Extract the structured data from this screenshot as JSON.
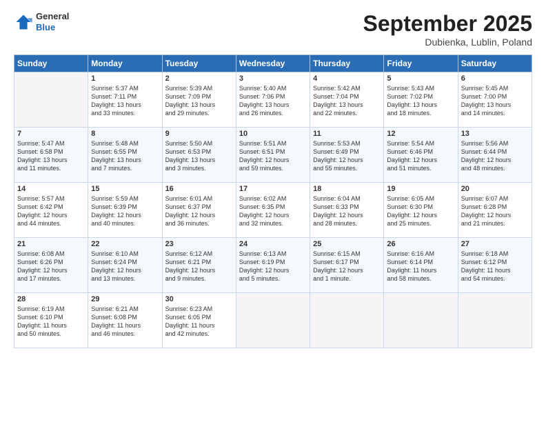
{
  "header": {
    "logo_general": "General",
    "logo_blue": "Blue",
    "month": "September 2025",
    "location": "Dubienka, Lublin, Poland"
  },
  "weekdays": [
    "Sunday",
    "Monday",
    "Tuesday",
    "Wednesday",
    "Thursday",
    "Friday",
    "Saturday"
  ],
  "weeks": [
    [
      {
        "day": "",
        "info": ""
      },
      {
        "day": "1",
        "info": "Sunrise: 5:37 AM\nSunset: 7:11 PM\nDaylight: 13 hours\nand 33 minutes."
      },
      {
        "day": "2",
        "info": "Sunrise: 5:39 AM\nSunset: 7:09 PM\nDaylight: 13 hours\nand 29 minutes."
      },
      {
        "day": "3",
        "info": "Sunrise: 5:40 AM\nSunset: 7:06 PM\nDaylight: 13 hours\nand 26 minutes."
      },
      {
        "day": "4",
        "info": "Sunrise: 5:42 AM\nSunset: 7:04 PM\nDaylight: 13 hours\nand 22 minutes."
      },
      {
        "day": "5",
        "info": "Sunrise: 5:43 AM\nSunset: 7:02 PM\nDaylight: 13 hours\nand 18 minutes."
      },
      {
        "day": "6",
        "info": "Sunrise: 5:45 AM\nSunset: 7:00 PM\nDaylight: 13 hours\nand 14 minutes."
      }
    ],
    [
      {
        "day": "7",
        "info": "Sunrise: 5:47 AM\nSunset: 6:58 PM\nDaylight: 13 hours\nand 11 minutes."
      },
      {
        "day": "8",
        "info": "Sunrise: 5:48 AM\nSunset: 6:55 PM\nDaylight: 13 hours\nand 7 minutes."
      },
      {
        "day": "9",
        "info": "Sunrise: 5:50 AM\nSunset: 6:53 PM\nDaylight: 13 hours\nand 3 minutes."
      },
      {
        "day": "10",
        "info": "Sunrise: 5:51 AM\nSunset: 6:51 PM\nDaylight: 12 hours\nand 59 minutes."
      },
      {
        "day": "11",
        "info": "Sunrise: 5:53 AM\nSunset: 6:49 PM\nDaylight: 12 hours\nand 55 minutes."
      },
      {
        "day": "12",
        "info": "Sunrise: 5:54 AM\nSunset: 6:46 PM\nDaylight: 12 hours\nand 51 minutes."
      },
      {
        "day": "13",
        "info": "Sunrise: 5:56 AM\nSunset: 6:44 PM\nDaylight: 12 hours\nand 48 minutes."
      }
    ],
    [
      {
        "day": "14",
        "info": "Sunrise: 5:57 AM\nSunset: 6:42 PM\nDaylight: 12 hours\nand 44 minutes."
      },
      {
        "day": "15",
        "info": "Sunrise: 5:59 AM\nSunset: 6:39 PM\nDaylight: 12 hours\nand 40 minutes."
      },
      {
        "day": "16",
        "info": "Sunrise: 6:01 AM\nSunset: 6:37 PM\nDaylight: 12 hours\nand 36 minutes."
      },
      {
        "day": "17",
        "info": "Sunrise: 6:02 AM\nSunset: 6:35 PM\nDaylight: 12 hours\nand 32 minutes."
      },
      {
        "day": "18",
        "info": "Sunrise: 6:04 AM\nSunset: 6:33 PM\nDaylight: 12 hours\nand 28 minutes."
      },
      {
        "day": "19",
        "info": "Sunrise: 6:05 AM\nSunset: 6:30 PM\nDaylight: 12 hours\nand 25 minutes."
      },
      {
        "day": "20",
        "info": "Sunrise: 6:07 AM\nSunset: 6:28 PM\nDaylight: 12 hours\nand 21 minutes."
      }
    ],
    [
      {
        "day": "21",
        "info": "Sunrise: 6:08 AM\nSunset: 6:26 PM\nDaylight: 12 hours\nand 17 minutes."
      },
      {
        "day": "22",
        "info": "Sunrise: 6:10 AM\nSunset: 6:24 PM\nDaylight: 12 hours\nand 13 minutes."
      },
      {
        "day": "23",
        "info": "Sunrise: 6:12 AM\nSunset: 6:21 PM\nDaylight: 12 hours\nand 9 minutes."
      },
      {
        "day": "24",
        "info": "Sunrise: 6:13 AM\nSunset: 6:19 PM\nDaylight: 12 hours\nand 5 minutes."
      },
      {
        "day": "25",
        "info": "Sunrise: 6:15 AM\nSunset: 6:17 PM\nDaylight: 12 hours\nand 1 minute."
      },
      {
        "day": "26",
        "info": "Sunrise: 6:16 AM\nSunset: 6:14 PM\nDaylight: 11 hours\nand 58 minutes."
      },
      {
        "day": "27",
        "info": "Sunrise: 6:18 AM\nSunset: 6:12 PM\nDaylight: 11 hours\nand 54 minutes."
      }
    ],
    [
      {
        "day": "28",
        "info": "Sunrise: 6:19 AM\nSunset: 6:10 PM\nDaylight: 11 hours\nand 50 minutes."
      },
      {
        "day": "29",
        "info": "Sunrise: 6:21 AM\nSunset: 6:08 PM\nDaylight: 11 hours\nand 46 minutes."
      },
      {
        "day": "30",
        "info": "Sunrise: 6:23 AM\nSunset: 6:05 PM\nDaylight: 11 hours\nand 42 minutes."
      },
      {
        "day": "",
        "info": ""
      },
      {
        "day": "",
        "info": ""
      },
      {
        "day": "",
        "info": ""
      },
      {
        "day": "",
        "info": ""
      }
    ]
  ]
}
